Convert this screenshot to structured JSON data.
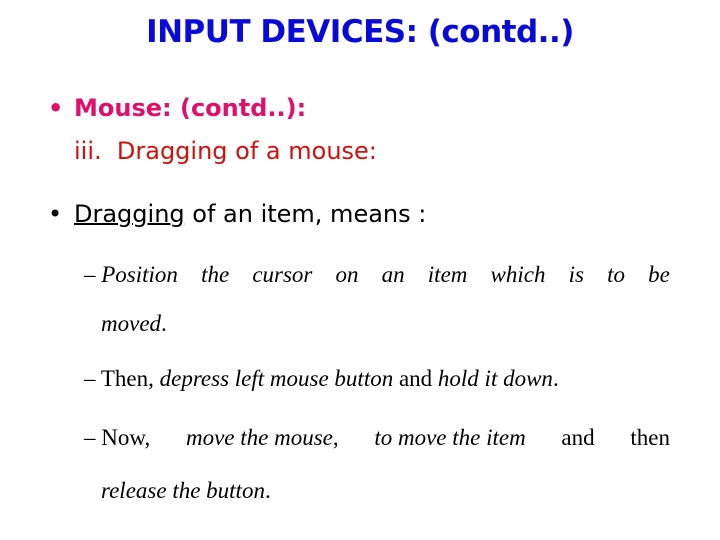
{
  "slide": {
    "title": "INPUT DEVICES: (contd..)",
    "colors": {
      "title": "#0A0AD8",
      "heading": "#E0106A",
      "subheading": "#D01010",
      "body": "#000000"
    },
    "heading": {
      "bullet": "•",
      "text": "Mouse: (contd..):"
    },
    "subheading": {
      "text": "iii.  Dragging of a mouse:"
    },
    "point": {
      "bullet": "•",
      "underlined": "Dragging",
      "rest": " of an item, means :"
    },
    "subpoints": [
      {
        "dash": "–",
        "line1_words": [
          "Position",
          "the",
          "cursor",
          "on",
          "an",
          "item",
          "which",
          "is",
          "to",
          "be"
        ],
        "line2": "moved",
        "line2_end": "."
      },
      {
        "dash": "–",
        "parts": [
          {
            "text": "Then, ",
            "italic": false
          },
          {
            "text": "depress left mouse button",
            "italic": true
          },
          {
            "text": " and ",
            "italic": false
          },
          {
            "text": "hold it down",
            "italic": true
          },
          {
            "text": ".",
            "italic": false
          }
        ]
      },
      {
        "dash": "–",
        "line1_words": [
          "Now,",
          "move the mouse",
          ",",
          "to move the item",
          "and",
          "then"
        ],
        "line2": "release the button",
        "line2_end": "."
      }
    ]
  }
}
